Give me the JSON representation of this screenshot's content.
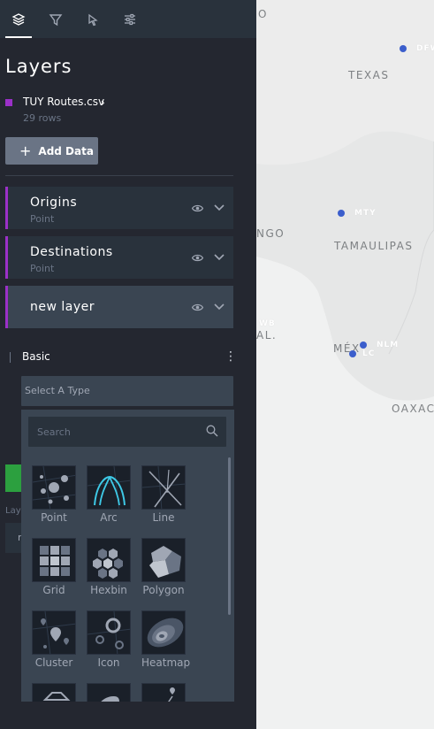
{
  "nav": {
    "tabs": [
      {
        "name": "layers-icon",
        "active": true
      },
      {
        "name": "filter-icon",
        "active": false
      },
      {
        "name": "interaction-icon",
        "active": false
      },
      {
        "name": "settings-icon",
        "active": false
      }
    ]
  },
  "panel": {
    "title": "Layers"
  },
  "dataset": {
    "name": "TUY Routes.csv",
    "rows": "29 rows",
    "color": "#9b30c8"
  },
  "add_data": {
    "label": "Add Data"
  },
  "layers": [
    {
      "name": "Origins",
      "type": "Point"
    },
    {
      "name": "Destinations",
      "type": "Point"
    },
    {
      "name": "new layer",
      "type": ""
    }
  ],
  "basic": {
    "label": "Basic"
  },
  "type_select": {
    "placeholder": "Select A Type"
  },
  "dropdown": {
    "search_placeholder": "Search",
    "types": [
      "Point",
      "Arc",
      "Line",
      "Grid",
      "Hexbin",
      "Polygon",
      "Cluster",
      "Icon",
      "Heatmap"
    ]
  },
  "behind": {
    "layer_label": "Lay",
    "field_text": "r"
  },
  "map": {
    "labels": [
      "O",
      "TEXAS",
      "NGO",
      "TAMAULIPAS",
      "AL.",
      "MÉX",
      "OAXAC"
    ],
    "cities": [
      "DFW",
      "MTY",
      "NLM",
      "LC",
      "WB"
    ]
  },
  "colors": {
    "accent": "#9b30c8",
    "point": "#3b5ecc",
    "panel": "#242730"
  }
}
